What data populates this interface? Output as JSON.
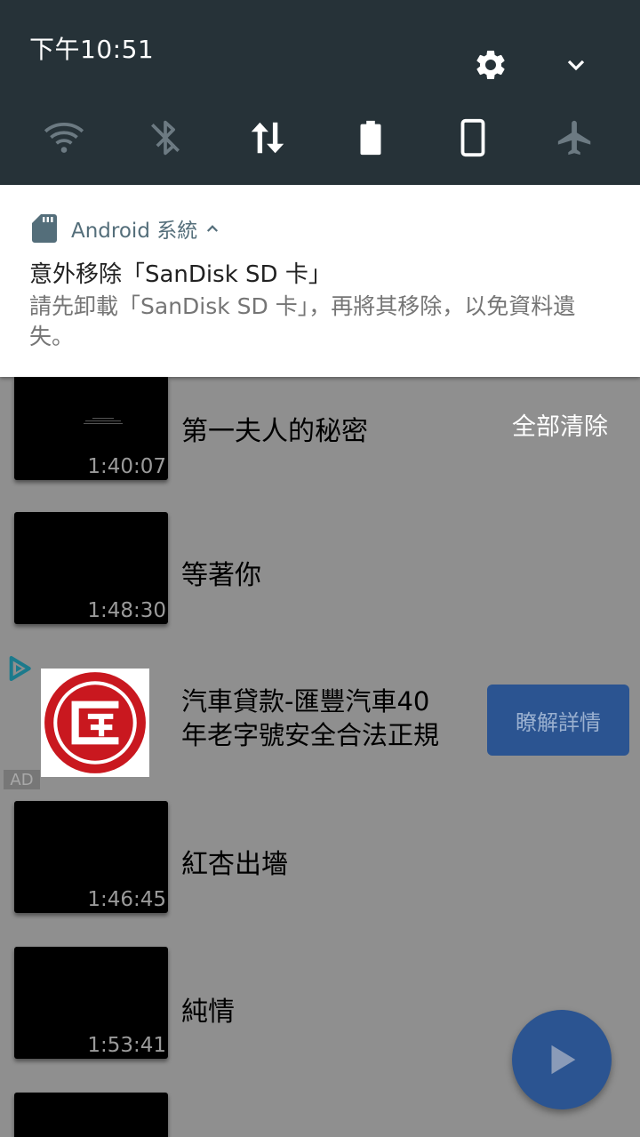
{
  "status_bar": {
    "time": "下午10:51"
  },
  "shade": {
    "settings_icon": "gear-icon",
    "expand_icon": "chevron-down-icon",
    "quick_tiles": [
      {
        "name": "wifi-icon",
        "state": "off"
      },
      {
        "name": "bluetooth-off-icon",
        "state": "off"
      },
      {
        "name": "mobile-data-icon",
        "state": "on"
      },
      {
        "name": "battery-icon",
        "state": "on"
      },
      {
        "name": "screen-rotation-icon",
        "state": "on"
      },
      {
        "name": "airplane-mode-icon",
        "state": "off"
      }
    ]
  },
  "notification": {
    "app_name": "Android 系統",
    "title": "意外移除「SanDisk SD 卡」",
    "body": "請先卸載「SanDisk SD 卡」，再將其移除，以免資料遺失。"
  },
  "list": {
    "clear_all": "全部清除",
    "videos": [
      {
        "title": "第一夫人的秘密",
        "duration": "1:40:07"
      },
      {
        "title": "等著你",
        "duration": "1:48:30"
      },
      {
        "title": "紅杏出墻",
        "duration": "1:46:45"
      },
      {
        "title": "純情",
        "duration": "1:53:41"
      }
    ],
    "ad": {
      "title_line1": "汽車貸款-匯豐汽車40",
      "title_line2": "年老字號安全合法正規",
      "cta": "瞭解詳情",
      "badge": "AD",
      "logo_char": "匯"
    }
  },
  "fab": {
    "icon": "play-icon"
  },
  "colors": {
    "shade_bg": "#263238",
    "accent": "#2b5491",
    "scrim": "#8f8f8f",
    "logo_red": "#c9181f"
  }
}
